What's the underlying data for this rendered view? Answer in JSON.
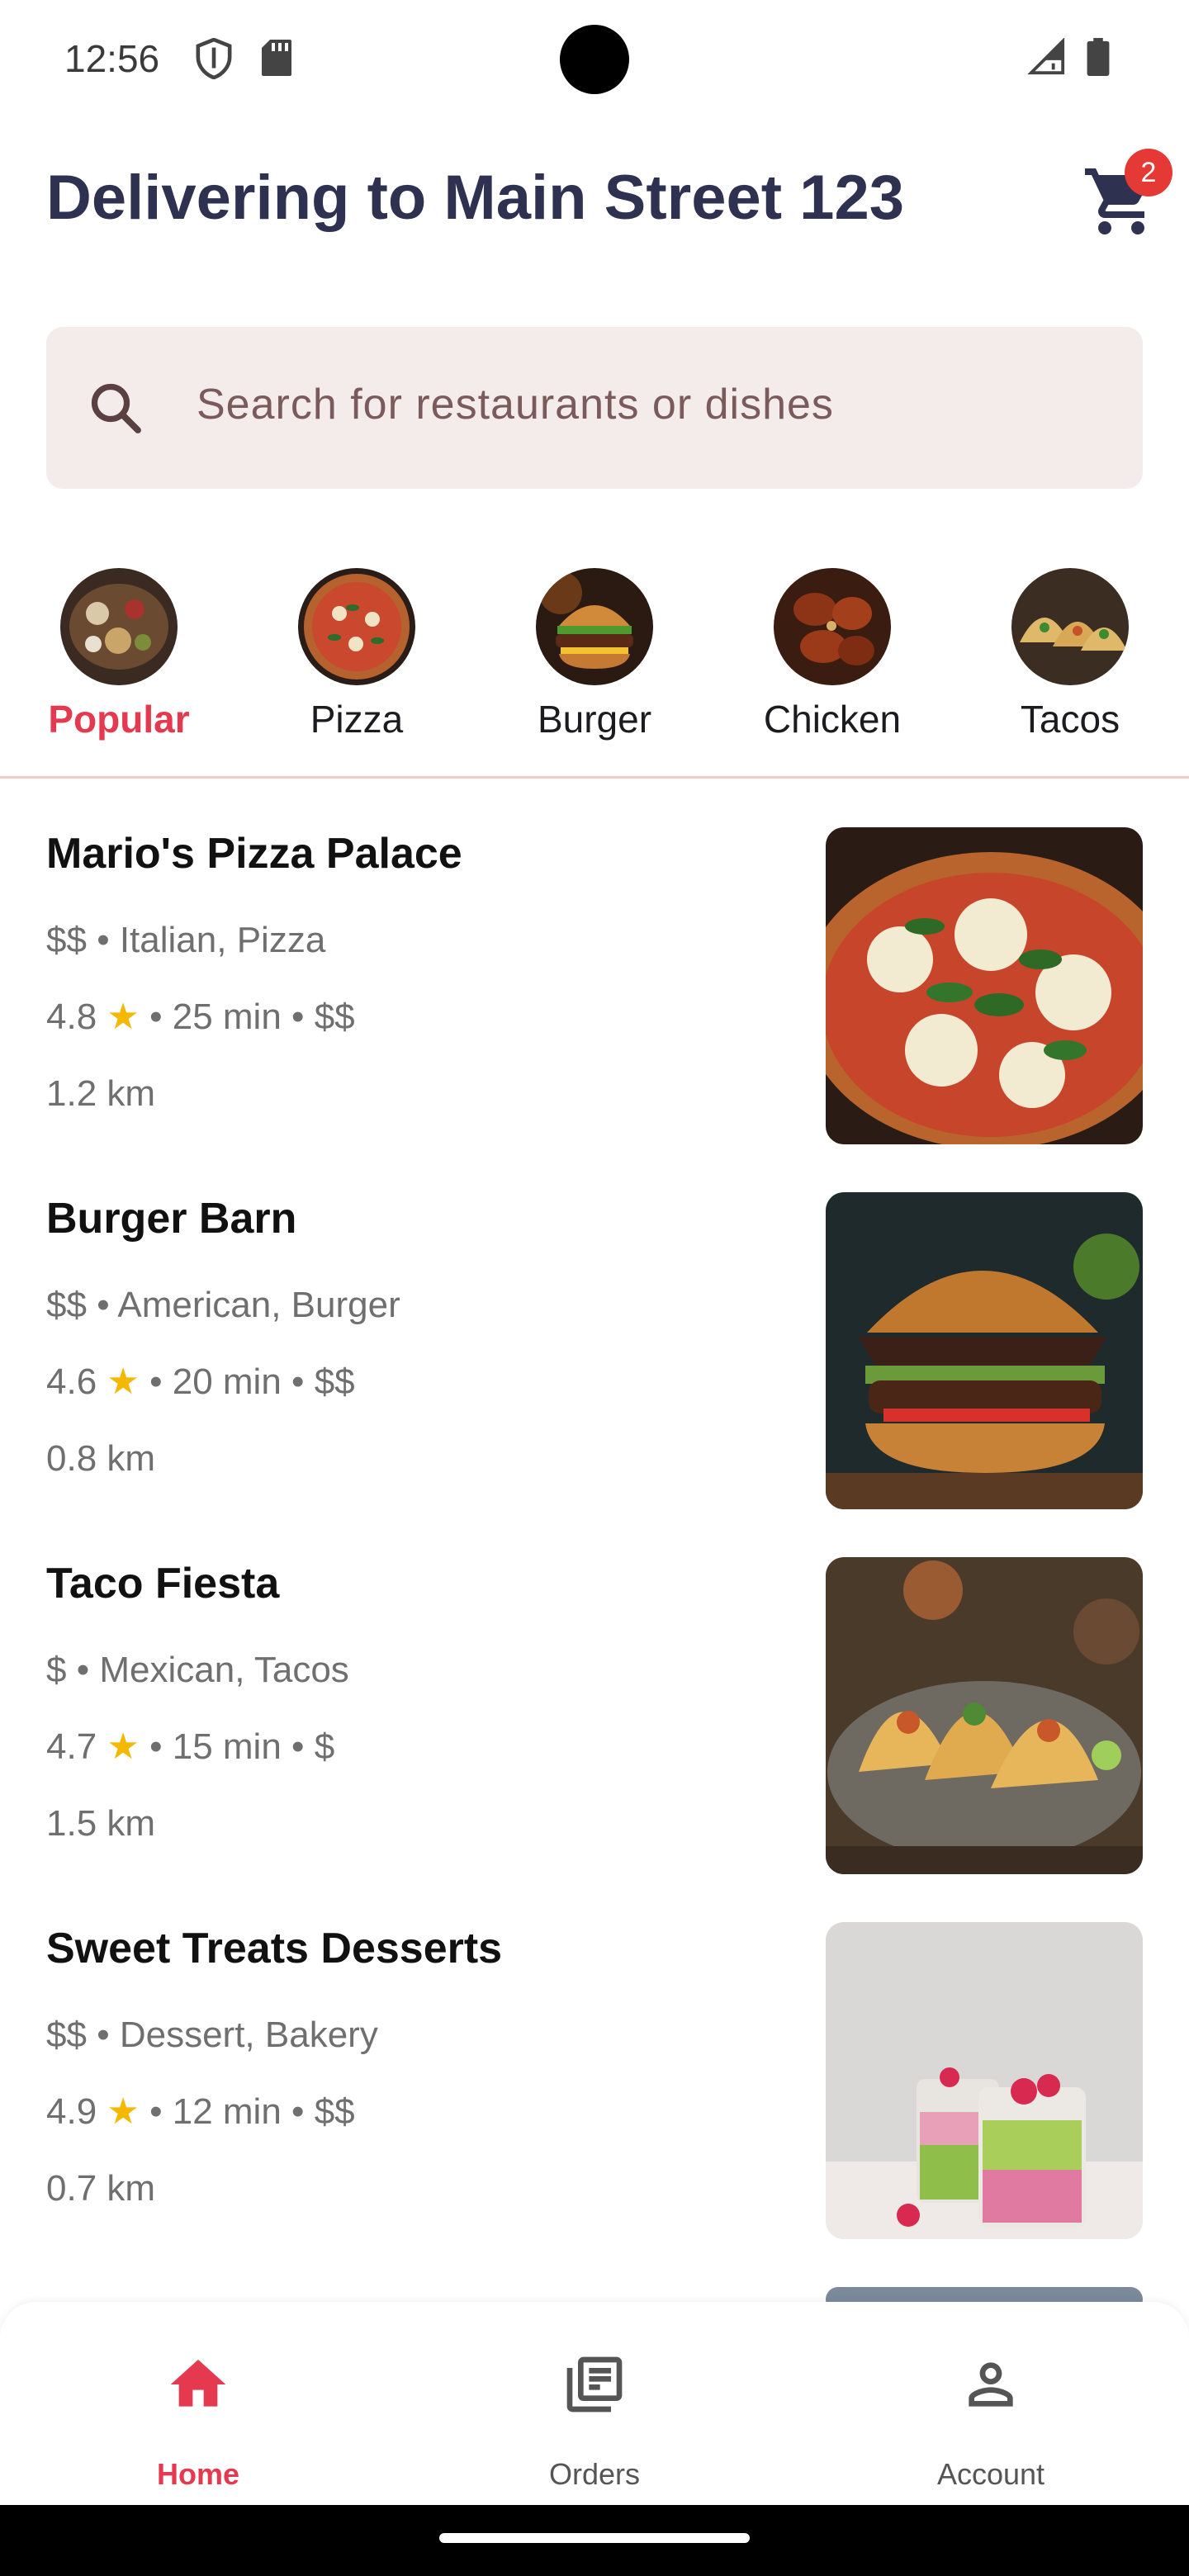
{
  "status_bar": {
    "time": "12:56"
  },
  "header": {
    "title": "Delivering to Main Street 123",
    "cart_count": "2"
  },
  "search": {
    "placeholder": "Search for restaurants or dishes"
  },
  "categories": [
    {
      "label": "Popular",
      "active": true
    },
    {
      "label": "Pizza",
      "active": false
    },
    {
      "label": "Burger",
      "active": false
    },
    {
      "label": "Chicken",
      "active": false
    },
    {
      "label": "Tacos",
      "active": false
    }
  ],
  "restaurants": [
    {
      "name": "Mario's Pizza Palace",
      "price": "$$",
      "cuisine": "Italian, Pizza",
      "rating": "4.8",
      "time": "25 min",
      "cost": "$$",
      "distance": "1.2 km"
    },
    {
      "name": "Burger Barn",
      "price": "$$",
      "cuisine": "American, Burger",
      "rating": "4.6",
      "time": "20 min",
      "cost": "$$",
      "distance": "0.8 km"
    },
    {
      "name": "Taco Fiesta",
      "price": "$",
      "cuisine": "Mexican, Tacos",
      "rating": "4.7",
      "time": "15 min",
      "cost": "$",
      "distance": "1.5 km"
    },
    {
      "name": "Sweet Treats Desserts",
      "price": "$$",
      "cuisine": "Dessert, Bakery",
      "rating": "4.9",
      "time": "12 min",
      "cost": "$$",
      "distance": "0.7 km"
    }
  ],
  "separator": "•",
  "star": "★",
  "bottom_nav": [
    {
      "label": "Home",
      "icon": "home-icon",
      "active": true
    },
    {
      "label": "Orders",
      "icon": "orders-icon",
      "active": false
    },
    {
      "label": "Account",
      "icon": "account-icon",
      "active": false
    }
  ],
  "colors": {
    "accent": "#e53950",
    "badge": "#e53935",
    "search_bg": "#f4ebeb",
    "star": "#f5b800",
    "title": "#2f3150"
  }
}
